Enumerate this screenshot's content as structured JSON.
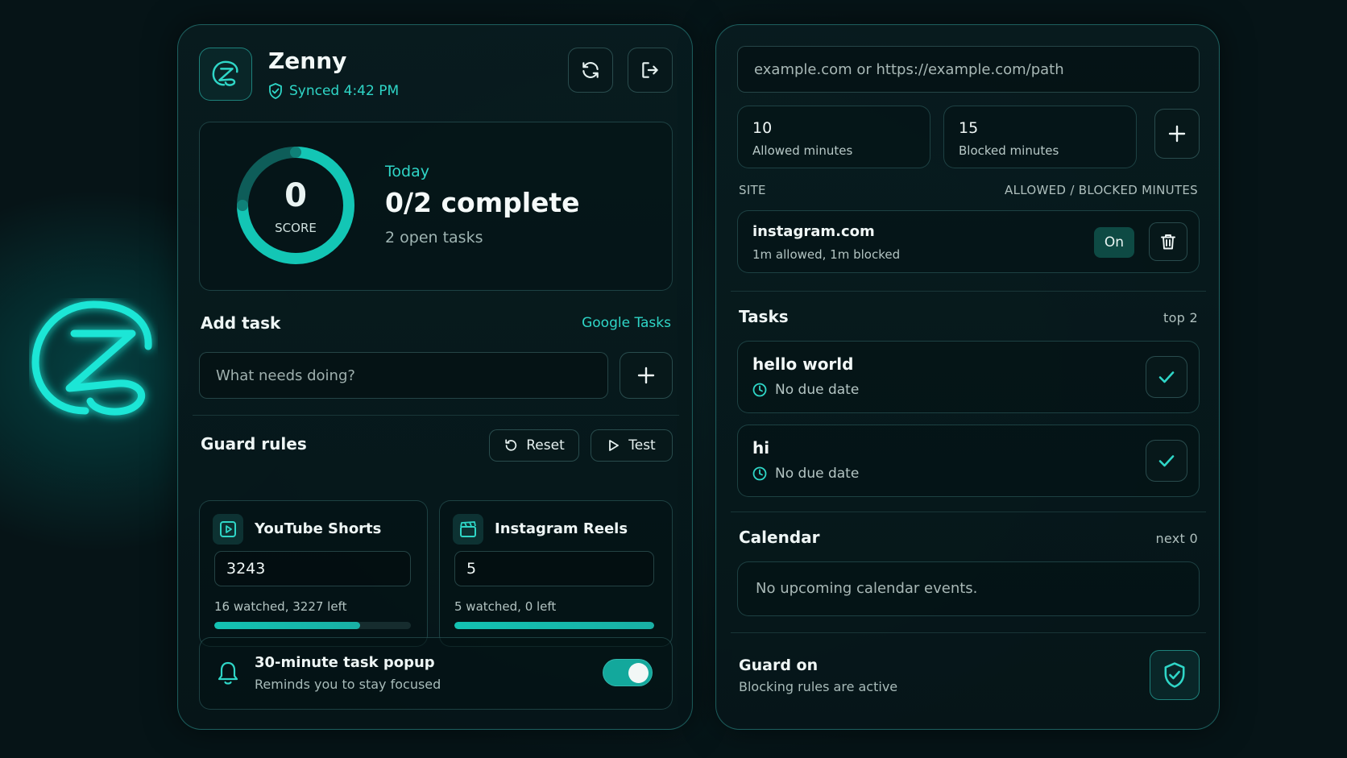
{
  "app": {
    "name": "Zenny",
    "sync_status": "Synced 4:42 PM"
  },
  "score": {
    "value": "0",
    "label": "SCORE",
    "progress_fraction": 0.0,
    "today_label": "Today",
    "complete_text": "0/2 complete",
    "open_tasks_text": "2 open tasks"
  },
  "add_task": {
    "title": "Add task",
    "google_link": "Google Tasks",
    "placeholder": "What needs doing?"
  },
  "guard_rules": {
    "title": "Guard rules",
    "reset_label": "Reset",
    "test_label": "Test",
    "rules": [
      {
        "name": "YouTube Shorts",
        "limit": "3243",
        "status": "16 watched, 3227 left",
        "progress_fraction": 0.74
      },
      {
        "name": "Instagram Reels",
        "limit": "5",
        "status": "5 watched, 0 left",
        "progress_fraction": 1.0
      }
    ]
  },
  "popup": {
    "title": "30-minute task popup",
    "subtitle": "Reminds you to stay focused",
    "enabled": true
  },
  "site_rules": {
    "url_placeholder": "example.com or https://example.com/path",
    "allowed_value": "10",
    "allowed_label": "Allowed minutes",
    "blocked_value": "15",
    "blocked_label": "Blocked minutes",
    "col_site": "SITE",
    "col_minutes": "ALLOWED / BLOCKED MINUTES",
    "sites": [
      {
        "name": "instagram.com",
        "detail": "1m allowed, 1m blocked",
        "state": "On"
      }
    ]
  },
  "tasks": {
    "title": "Tasks",
    "count_label": "top 2",
    "items": [
      {
        "title": "hello world",
        "due": "No due date"
      },
      {
        "title": "hi",
        "due": "No due date"
      }
    ]
  },
  "calendar": {
    "title": "Calendar",
    "count_label": "next 0",
    "empty_text": "No upcoming calendar events."
  },
  "guard": {
    "title": "Guard on",
    "subtitle": "Blocking rules are active"
  },
  "colors": {
    "accent": "#2fd6c7",
    "background": "#061417",
    "panel_border": "#2d9691"
  }
}
